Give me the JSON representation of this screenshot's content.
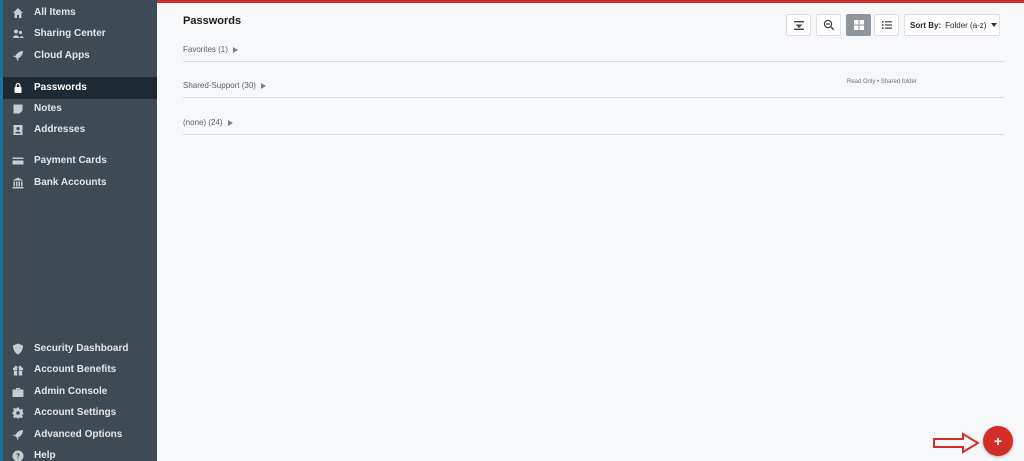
{
  "sidebar": {
    "items": [
      {
        "label": "All Items",
        "icon": "home-icon",
        "active": false
      },
      {
        "label": "Sharing Center",
        "icon": "sharing-icon",
        "active": false
      },
      {
        "label": "Cloud Apps",
        "icon": "rocket-icon",
        "active": false
      },
      {
        "label": "Passwords",
        "icon": "lock-icon",
        "active": true
      },
      {
        "label": "Notes",
        "icon": "note-icon",
        "active": false
      },
      {
        "label": "Addresses",
        "icon": "address-book-icon",
        "active": false
      },
      {
        "label": "Payment Cards",
        "icon": "credit-card-icon",
        "active": false
      },
      {
        "label": "Bank Accounts",
        "icon": "bank-icon",
        "active": false
      },
      {
        "label": "Security Dashboard",
        "icon": "shield-icon",
        "active": false
      },
      {
        "label": "Account Benefits",
        "icon": "gift-icon",
        "active": false
      },
      {
        "label": "Admin Console",
        "icon": "briefcase-icon",
        "active": false
      },
      {
        "label": "Account Settings",
        "icon": "gear-icon",
        "active": false
      },
      {
        "label": "Advanced Options",
        "icon": "rocket-icon",
        "active": false
      },
      {
        "label": "Help",
        "icon": "question-icon",
        "active": false
      }
    ]
  },
  "main": {
    "title": "Passwords",
    "toolbar": {
      "sort_label": "Sort By:",
      "sort_value": "Folder (a-z)"
    },
    "groups": [
      {
        "title": "Favorites (1)",
        "note": ""
      },
      {
        "title": "Shared-Support (30)",
        "note": "Read Only • Shared folder"
      },
      {
        "title": "(none) (24)",
        "note": ""
      }
    ],
    "fab_label": "+"
  },
  "colors": {
    "accent": "#d32d27",
    "sidebar_bg": "#3e4a54",
    "sidebar_active": "#1e2a33"
  }
}
